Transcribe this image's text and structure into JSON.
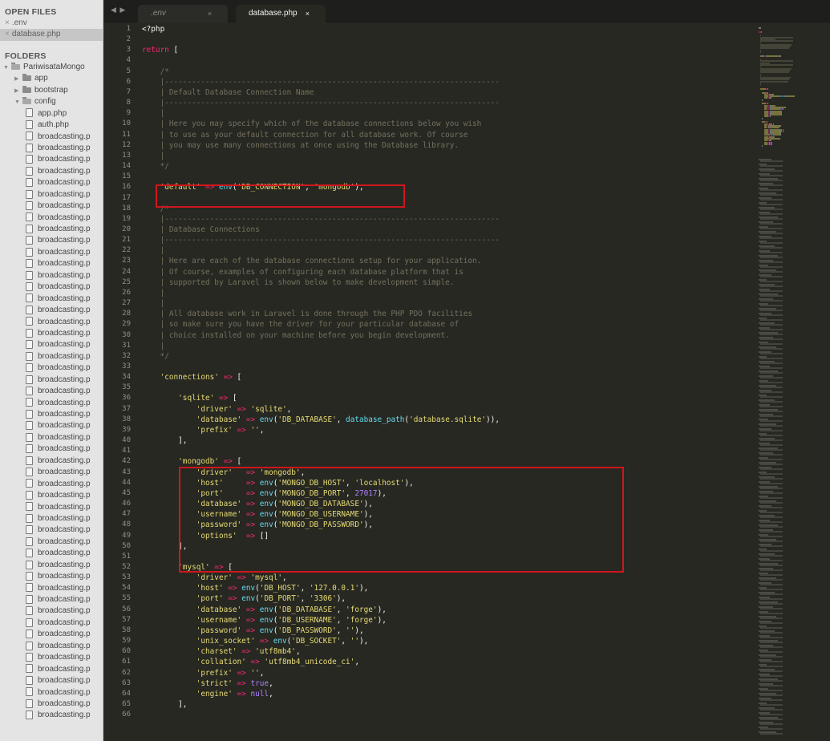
{
  "sidebar": {
    "open_files_title": "OPEN FILES",
    "open_files": [
      {
        "close": "×",
        "name": ".env",
        "selected": false
      },
      {
        "close": "×",
        "name": "database.php",
        "selected": true
      }
    ],
    "folders_title": "FOLDERS",
    "tree": [
      {
        "kind": "folder-open",
        "arrow": "▼",
        "name": "PariwisataMongo",
        "depth": 0
      },
      {
        "kind": "folder",
        "arrow": "▶",
        "name": "app",
        "depth": 1
      },
      {
        "kind": "folder",
        "arrow": "▶",
        "name": "bootstrap",
        "depth": 1
      },
      {
        "kind": "folder-open",
        "arrow": "▼",
        "name": "config",
        "depth": 1
      },
      {
        "kind": "file",
        "arrow": "",
        "name": "app.php",
        "depth": 2
      },
      {
        "kind": "file",
        "arrow": "",
        "name": "auth.php",
        "depth": 2
      }
    ],
    "repeat_file_name": "broadcasting.p",
    "repeat_file_count": 51
  },
  "tabs": {
    "nav": "◀ ▶",
    "items": [
      {
        "label": ".env",
        "close": "×",
        "active": false
      },
      {
        "label": "database.php",
        "close": "×",
        "active": true
      }
    ]
  },
  "editor": {
    "language": "php",
    "highlight_color": "#d0161d",
    "lines": [
      [
        [
          "t",
          "<?php"
        ]
      ],
      [],
      [
        [
          "k",
          "return"
        ],
        [
          "t",
          " ["
        ]
      ],
      [],
      [
        [
          "i",
          "    "
        ],
        [
          "c",
          "/*"
        ]
      ],
      [
        [
          "i",
          "    "
        ],
        [
          "c",
          "|--------------------------------------------------------------------------"
        ]
      ],
      [
        [
          "i",
          "    "
        ],
        [
          "c",
          "| Default Database Connection Name"
        ]
      ],
      [
        [
          "i",
          "    "
        ],
        [
          "c",
          "|--------------------------------------------------------------------------"
        ]
      ],
      [
        [
          "i",
          "    "
        ],
        [
          "c",
          "|"
        ]
      ],
      [
        [
          "i",
          "    "
        ],
        [
          "c",
          "| Here you may specify which of the database connections below you wish"
        ]
      ],
      [
        [
          "i",
          "    "
        ],
        [
          "c",
          "| to use as your default connection for all database work. Of course"
        ]
      ],
      [
        [
          "i",
          "    "
        ],
        [
          "c",
          "| you may use many connections at once using the Database library."
        ]
      ],
      [
        [
          "i",
          "    "
        ],
        [
          "c",
          "|"
        ]
      ],
      [
        [
          "i",
          "    "
        ],
        [
          "c",
          "*/"
        ]
      ],
      [],
      [
        [
          "i",
          "    "
        ],
        [
          "s",
          "'default'"
        ],
        [
          "k",
          " =>"
        ],
        [
          "t",
          " "
        ],
        [
          "f",
          "env"
        ],
        [
          "t",
          "("
        ],
        [
          "s",
          "'DB_CONNECTION'"
        ],
        [
          "t",
          ", "
        ],
        [
          "s",
          "'mongodb'"
        ],
        [
          "t",
          "),"
        ]
      ],
      [],
      [
        [
          "i",
          "    "
        ],
        [
          "c",
          "/*"
        ]
      ],
      [
        [
          "i",
          "    "
        ],
        [
          "c",
          "|--------------------------------------------------------------------------"
        ]
      ],
      [
        [
          "i",
          "    "
        ],
        [
          "c",
          "| Database Connections"
        ]
      ],
      [
        [
          "i",
          "    "
        ],
        [
          "c",
          "|--------------------------------------------------------------------------"
        ]
      ],
      [
        [
          "i",
          "    "
        ],
        [
          "c",
          "|"
        ]
      ],
      [
        [
          "i",
          "    "
        ],
        [
          "c",
          "| Here are each of the database connections setup for your application."
        ]
      ],
      [
        [
          "i",
          "    "
        ],
        [
          "c",
          "| Of course, examples of configuring each database platform that is"
        ]
      ],
      [
        [
          "i",
          "    "
        ],
        [
          "c",
          "| supported by Laravel is shown below to make development simple."
        ]
      ],
      [
        [
          "i",
          "    "
        ],
        [
          "c",
          "|"
        ]
      ],
      [
        [
          "i",
          "    "
        ],
        [
          "c",
          "|"
        ]
      ],
      [
        [
          "i",
          "    "
        ],
        [
          "c",
          "| All database work in Laravel is done through the PHP PDO facilities"
        ]
      ],
      [
        [
          "i",
          "    "
        ],
        [
          "c",
          "| so make sure you have the driver for your particular database of"
        ]
      ],
      [
        [
          "i",
          "    "
        ],
        [
          "c",
          "| choice installed on your machine before you begin development."
        ]
      ],
      [
        [
          "i",
          "    "
        ],
        [
          "c",
          "|"
        ]
      ],
      [
        [
          "i",
          "    "
        ],
        [
          "c",
          "*/"
        ]
      ],
      [],
      [
        [
          "i",
          "    "
        ],
        [
          "s",
          "'connections'"
        ],
        [
          "k",
          " =>"
        ],
        [
          "t",
          " ["
        ]
      ],
      [],
      [
        [
          "i",
          "        "
        ],
        [
          "s",
          "'sqlite'"
        ],
        [
          "k",
          " =>"
        ],
        [
          "t",
          " ["
        ]
      ],
      [
        [
          "i",
          "            "
        ],
        [
          "s",
          "'driver'"
        ],
        [
          "k",
          " =>"
        ],
        [
          "t",
          " "
        ],
        [
          "s",
          "'sqlite'"
        ],
        [
          "t",
          ","
        ]
      ],
      [
        [
          "i",
          "            "
        ],
        [
          "s",
          "'database'"
        ],
        [
          "k",
          " =>"
        ],
        [
          "t",
          " "
        ],
        [
          "f",
          "env"
        ],
        [
          "t",
          "("
        ],
        [
          "s",
          "'DB_DATABASE'"
        ],
        [
          "t",
          ", "
        ],
        [
          "f",
          "database_path"
        ],
        [
          "t",
          "("
        ],
        [
          "s",
          "'database.sqlite'"
        ],
        [
          "t",
          ")),"
        ]
      ],
      [
        [
          "i",
          "            "
        ],
        [
          "s",
          "'prefix'"
        ],
        [
          "k",
          " =>"
        ],
        [
          "t",
          " "
        ],
        [
          "s",
          "''"
        ],
        [
          "t",
          ","
        ]
      ],
      [
        [
          "i",
          "        "
        ],
        [
          "t",
          "],"
        ]
      ],
      [],
      [
        [
          "i",
          "        "
        ],
        [
          "s",
          "'mongodb'"
        ],
        [
          "k",
          " =>"
        ],
        [
          "t",
          " ["
        ]
      ],
      [
        [
          "i",
          "            "
        ],
        [
          "s",
          "'driver'"
        ],
        [
          "k",
          "   =>"
        ],
        [
          "t",
          " "
        ],
        [
          "s",
          "'mongodb'"
        ],
        [
          "t",
          ","
        ]
      ],
      [
        [
          "i",
          "            "
        ],
        [
          "s",
          "'host'"
        ],
        [
          "k",
          "     =>"
        ],
        [
          "t",
          " "
        ],
        [
          "f",
          "env"
        ],
        [
          "t",
          "("
        ],
        [
          "s",
          "'MONGO_DB_HOST'"
        ],
        [
          "t",
          ", "
        ],
        [
          "s",
          "'localhost'"
        ],
        [
          "t",
          "),"
        ]
      ],
      [
        [
          "i",
          "            "
        ],
        [
          "s",
          "'port'"
        ],
        [
          "k",
          "     =>"
        ],
        [
          "t",
          " "
        ],
        [
          "f",
          "env"
        ],
        [
          "t",
          "("
        ],
        [
          "s",
          "'MONGO_DB_PORT'"
        ],
        [
          "t",
          ", "
        ],
        [
          "n",
          "27017"
        ],
        [
          "t",
          "),"
        ]
      ],
      [
        [
          "i",
          "            "
        ],
        [
          "s",
          "'database'"
        ],
        [
          "k",
          " =>"
        ],
        [
          "t",
          " "
        ],
        [
          "f",
          "env"
        ],
        [
          "t",
          "("
        ],
        [
          "s",
          "'MONGO_DB_DATABASE'"
        ],
        [
          "t",
          "),"
        ]
      ],
      [
        [
          "i",
          "            "
        ],
        [
          "s",
          "'username'"
        ],
        [
          "k",
          " =>"
        ],
        [
          "t",
          " "
        ],
        [
          "f",
          "env"
        ],
        [
          "t",
          "("
        ],
        [
          "s",
          "'MONGO_DB_USERNAME'"
        ],
        [
          "t",
          "),"
        ]
      ],
      [
        [
          "i",
          "            "
        ],
        [
          "s",
          "'password'"
        ],
        [
          "k",
          " =>"
        ],
        [
          "t",
          " "
        ],
        [
          "f",
          "env"
        ],
        [
          "t",
          "("
        ],
        [
          "s",
          "'MONGO_DB_PASSWORD'"
        ],
        [
          "t",
          "),"
        ]
      ],
      [
        [
          "i",
          "            "
        ],
        [
          "s",
          "'options'"
        ],
        [
          "k",
          "  =>"
        ],
        [
          "t",
          " []"
        ]
      ],
      [
        [
          "i",
          "        "
        ],
        [
          "t",
          "],"
        ]
      ],
      [],
      [
        [
          "i",
          "        "
        ],
        [
          "s",
          "'mysql'"
        ],
        [
          "k",
          " =>"
        ],
        [
          "t",
          " ["
        ]
      ],
      [
        [
          "i",
          "            "
        ],
        [
          "s",
          "'driver'"
        ],
        [
          "k",
          " =>"
        ],
        [
          "t",
          " "
        ],
        [
          "s",
          "'mysql'"
        ],
        [
          "t",
          ","
        ]
      ],
      [
        [
          "i",
          "            "
        ],
        [
          "s",
          "'host'"
        ],
        [
          "k",
          " =>"
        ],
        [
          "t",
          " "
        ],
        [
          "f",
          "env"
        ],
        [
          "t",
          "("
        ],
        [
          "s",
          "'DB_HOST'"
        ],
        [
          "t",
          ", "
        ],
        [
          "s",
          "'127.0.0.1'"
        ],
        [
          "t",
          "),"
        ]
      ],
      [
        [
          "i",
          "            "
        ],
        [
          "s",
          "'port'"
        ],
        [
          "k",
          " =>"
        ],
        [
          "t",
          " "
        ],
        [
          "f",
          "env"
        ],
        [
          "t",
          "("
        ],
        [
          "s",
          "'DB_PORT'"
        ],
        [
          "t",
          ", "
        ],
        [
          "s",
          "'3306'"
        ],
        [
          "t",
          "),"
        ]
      ],
      [
        [
          "i",
          "            "
        ],
        [
          "s",
          "'database'"
        ],
        [
          "k",
          " =>"
        ],
        [
          "t",
          " "
        ],
        [
          "f",
          "env"
        ],
        [
          "t",
          "("
        ],
        [
          "s",
          "'DB_DATABASE'"
        ],
        [
          "t",
          ", "
        ],
        [
          "s",
          "'forge'"
        ],
        [
          "t",
          "),"
        ]
      ],
      [
        [
          "i",
          "            "
        ],
        [
          "s",
          "'username'"
        ],
        [
          "k",
          " =>"
        ],
        [
          "t",
          " "
        ],
        [
          "f",
          "env"
        ],
        [
          "t",
          "("
        ],
        [
          "s",
          "'DB_USERNAME'"
        ],
        [
          "t",
          ", "
        ],
        [
          "s",
          "'forge'"
        ],
        [
          "t",
          "),"
        ]
      ],
      [
        [
          "i",
          "            "
        ],
        [
          "s",
          "'password'"
        ],
        [
          "k",
          " =>"
        ],
        [
          "t",
          " "
        ],
        [
          "f",
          "env"
        ],
        [
          "t",
          "("
        ],
        [
          "s",
          "'DB_PASSWORD'"
        ],
        [
          "t",
          ", "
        ],
        [
          "s",
          "''"
        ],
        [
          "t",
          "),"
        ]
      ],
      [
        [
          "i",
          "            "
        ],
        [
          "s",
          "'unix_socket'"
        ],
        [
          "k",
          " =>"
        ],
        [
          "t",
          " "
        ],
        [
          "f",
          "env"
        ],
        [
          "t",
          "("
        ],
        [
          "s",
          "'DB_SOCKET'"
        ],
        [
          "t",
          ", "
        ],
        [
          "s",
          "''"
        ],
        [
          "t",
          "),"
        ]
      ],
      [
        [
          "i",
          "            "
        ],
        [
          "s",
          "'charset'"
        ],
        [
          "k",
          " =>"
        ],
        [
          "t",
          " "
        ],
        [
          "s",
          "'utf8mb4'"
        ],
        [
          "t",
          ","
        ]
      ],
      [
        [
          "i",
          "            "
        ],
        [
          "s",
          "'collation'"
        ],
        [
          "k",
          " =>"
        ],
        [
          "t",
          " "
        ],
        [
          "s",
          "'utf8mb4_unicode_ci'"
        ],
        [
          "t",
          ","
        ]
      ],
      [
        [
          "i",
          "            "
        ],
        [
          "s",
          "'prefix'"
        ],
        [
          "k",
          " =>"
        ],
        [
          "t",
          " "
        ],
        [
          "s",
          "''"
        ],
        [
          "t",
          ","
        ]
      ],
      [
        [
          "i",
          "            "
        ],
        [
          "s",
          "'strict'"
        ],
        [
          "k",
          " =>"
        ],
        [
          "t",
          " "
        ],
        [
          "n",
          "true"
        ],
        [
          "t",
          ","
        ]
      ],
      [
        [
          "i",
          "            "
        ],
        [
          "s",
          "'engine'"
        ],
        [
          "k",
          " =>"
        ],
        [
          "t",
          " "
        ],
        [
          "n",
          "null"
        ],
        [
          "t",
          ","
        ]
      ],
      [
        [
          "i",
          "        "
        ],
        [
          "t",
          "],"
        ]
      ],
      []
    ]
  }
}
